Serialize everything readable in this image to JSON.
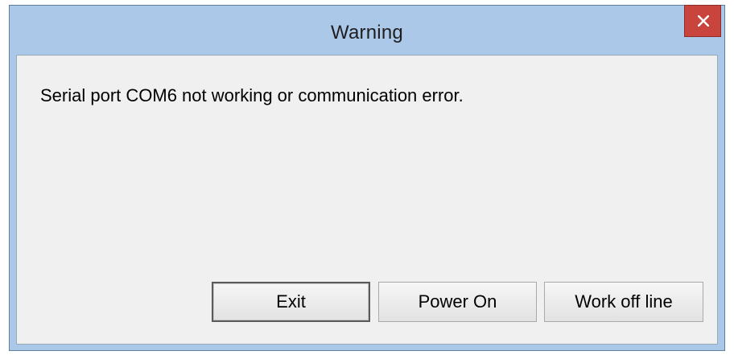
{
  "window": {
    "title": "Warning",
    "close_icon": "close-icon"
  },
  "message": "Serial port COM6 not working or communication error.",
  "buttons": {
    "exit": "Exit",
    "power_on": "Power On",
    "work_off_line": "Work off line"
  },
  "colors": {
    "title_bar": "#acc8e8",
    "close_button": "#c9443d",
    "client_area": "#f0f0f0"
  }
}
